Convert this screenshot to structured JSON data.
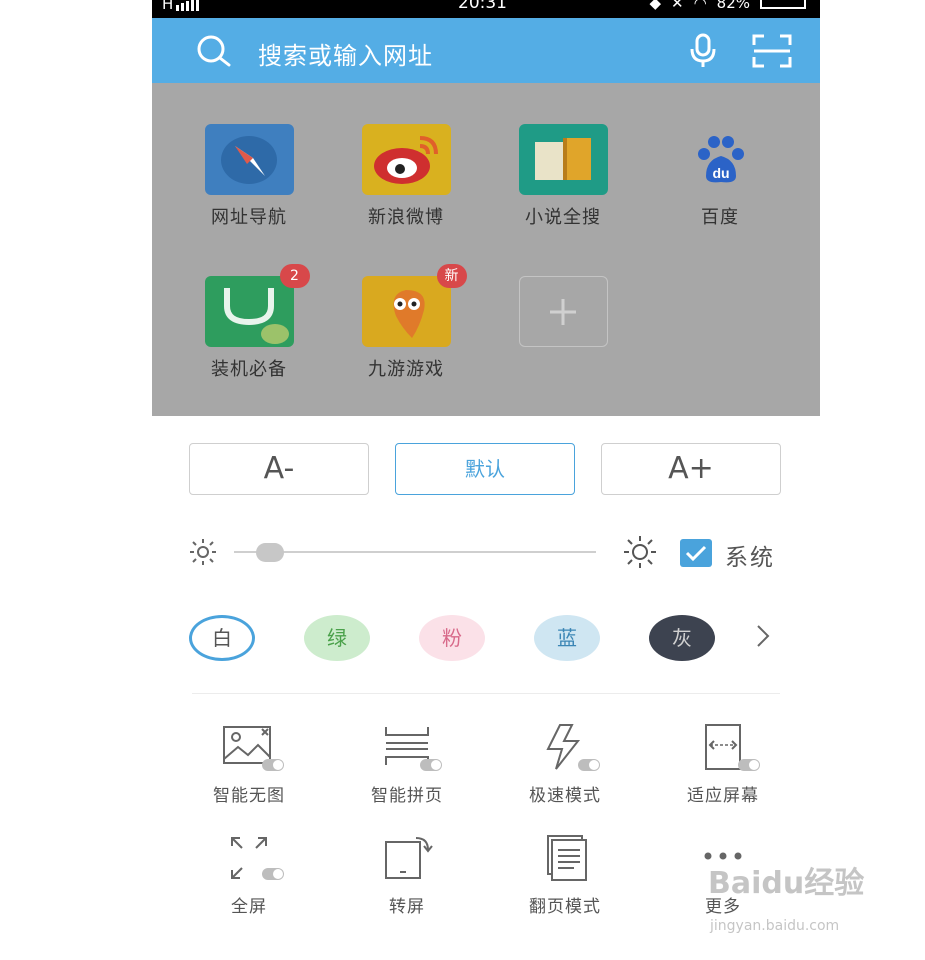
{
  "status_bar": {
    "network": "H",
    "time": "20:31",
    "battery": "82%"
  },
  "search": {
    "placeholder": "搜索或输入网址",
    "icons": [
      "search-icon",
      "microphone-icon",
      "scan-icon"
    ]
  },
  "shortcuts": [
    {
      "label": "网址导航",
      "icon": "compass-icon",
      "color": "#3f7fbf"
    },
    {
      "label": "新浪微博",
      "icon": "weibo-icon",
      "color": "#d9b11f"
    },
    {
      "label": "小说全搜",
      "icon": "book-icon",
      "color": "#1f9b86"
    },
    {
      "label": "百度",
      "icon": "baidu-paw-icon",
      "color": "#2b63c7"
    },
    {
      "label": "装机必备",
      "icon": "shopping-bag-android-icon",
      "color": "#2e9d5e",
      "badge": "2"
    },
    {
      "label": "九游游戏",
      "icon": "game-mascot-icon",
      "color": "#d9a91f",
      "badge": "新"
    },
    {
      "label": "",
      "icon": "add-icon"
    }
  ],
  "font_size": {
    "decrease": "A-",
    "default": "默认",
    "increase": "A+"
  },
  "brightness": {
    "level": 0.09,
    "system_label": "系统",
    "system_checked": true
  },
  "themes": [
    {
      "label": "白",
      "bg": "#ffffff",
      "fg": "#555555",
      "selected": true
    },
    {
      "label": "绿",
      "bg": "#cdeccd",
      "fg": "#4aa14a"
    },
    {
      "label": "粉",
      "bg": "#fbe1e8",
      "fg": "#d86a8a"
    },
    {
      "label": "蓝",
      "bg": "#cfe6f2",
      "fg": "#3b86b5"
    },
    {
      "label": "灰",
      "bg": "#3d4350",
      "fg": "#d0d0d0"
    }
  ],
  "features": [
    {
      "label": "智能无图",
      "icon": "no-image-icon"
    },
    {
      "label": "智能拼页",
      "icon": "page-merge-icon"
    },
    {
      "label": "极速模式",
      "icon": "lightning-icon"
    },
    {
      "label": "适应屏幕",
      "icon": "fit-screen-icon"
    },
    {
      "label": "全屏",
      "icon": "fullscreen-icon"
    },
    {
      "label": "转屏",
      "icon": "rotate-screen-icon"
    },
    {
      "label": "翻页模式",
      "icon": "page-turn-icon"
    },
    {
      "label": "更多",
      "icon": "more-dots-icon"
    }
  ],
  "watermark": {
    "text": "Baidu经验",
    "url": "jingyan.baidu.com"
  },
  "colors": {
    "accent": "#54ade5",
    "dim_overlay": "#a7a7a7"
  }
}
